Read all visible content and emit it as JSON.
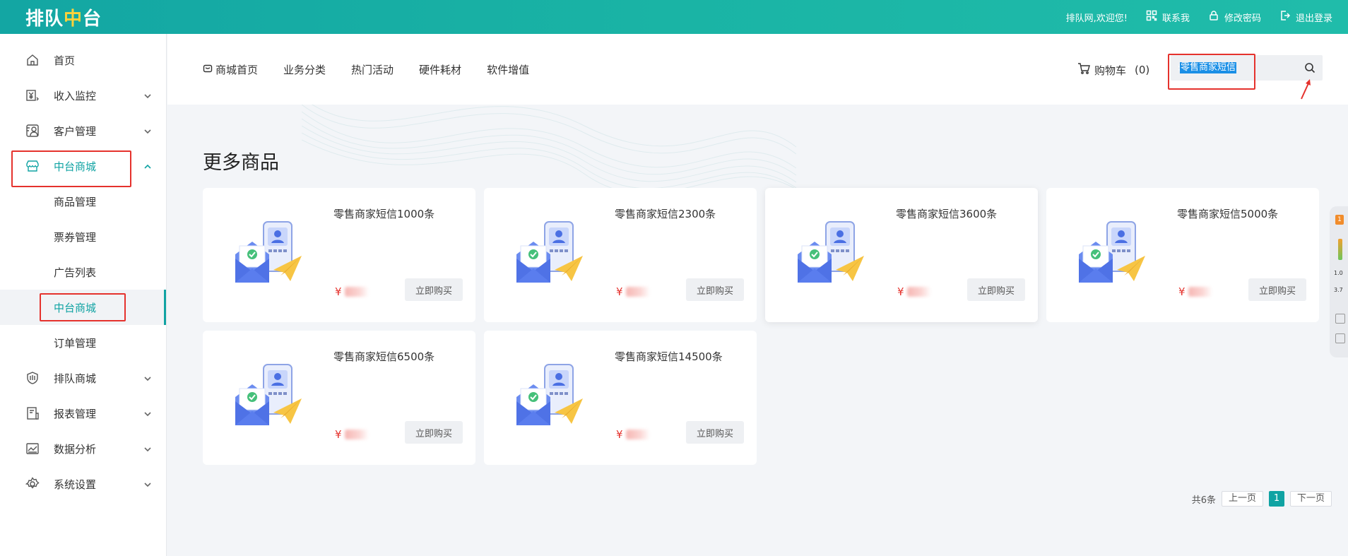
{
  "topbar": {
    "logo_part1": "排队",
    "logo_part2": "中",
    "logo_part3": "台",
    "welcome": "排队网,欢迎您!",
    "contact": "联系我",
    "change_password": "修改密码",
    "logout": "退出登录"
  },
  "sidebar": {
    "items": [
      {
        "label": "首页",
        "icon": "home-icon"
      },
      {
        "label": "收入监控",
        "icon": "income-icon"
      },
      {
        "label": "客户管理",
        "icon": "customer-icon"
      },
      {
        "label": "中台商城",
        "icon": "store-icon"
      },
      {
        "label": "排队商城",
        "icon": "shield-icon"
      },
      {
        "label": "报表管理",
        "icon": "report-icon"
      },
      {
        "label": "数据分析",
        "icon": "chart-icon"
      },
      {
        "label": "系统设置",
        "icon": "gear-icon"
      }
    ],
    "sub_items": [
      {
        "label": "商品管理"
      },
      {
        "label": "票券管理"
      },
      {
        "label": "广告列表"
      },
      {
        "label": "中台商城"
      },
      {
        "label": "订单管理"
      }
    ]
  },
  "subnav": {
    "home": "商城首页",
    "category": "业务分类",
    "hot": "热门活动",
    "hardware": "硬件耗材",
    "software": "软件增值",
    "cart_label": "购物车",
    "cart_count": "(0)"
  },
  "search": {
    "value": "零售商家短信"
  },
  "main": {
    "section_title": "更多商品",
    "buy_label": "立即购买",
    "currency": "¥",
    "products": [
      {
        "name": "零售商家短信1000条"
      },
      {
        "name": "零售商家短信2300条"
      },
      {
        "name": "零售商家短信3600条"
      },
      {
        "name": "零售商家短信5000条"
      },
      {
        "name": "零售商家短信6500条"
      },
      {
        "name": "零售商家短信14500条"
      }
    ]
  },
  "pager": {
    "total": "共6条",
    "prev": "上一页",
    "current": "1",
    "next": "下一页"
  },
  "float_widget": {
    "badge": "1",
    "speed1": "1.0",
    "speed2": "3.7"
  },
  "colors": {
    "accent": "#10a3a3",
    "topbar": "#1ab4a5",
    "logo_highlight": "#ffd23a",
    "price": "#e5322d",
    "annotation": "#e5322d"
  }
}
